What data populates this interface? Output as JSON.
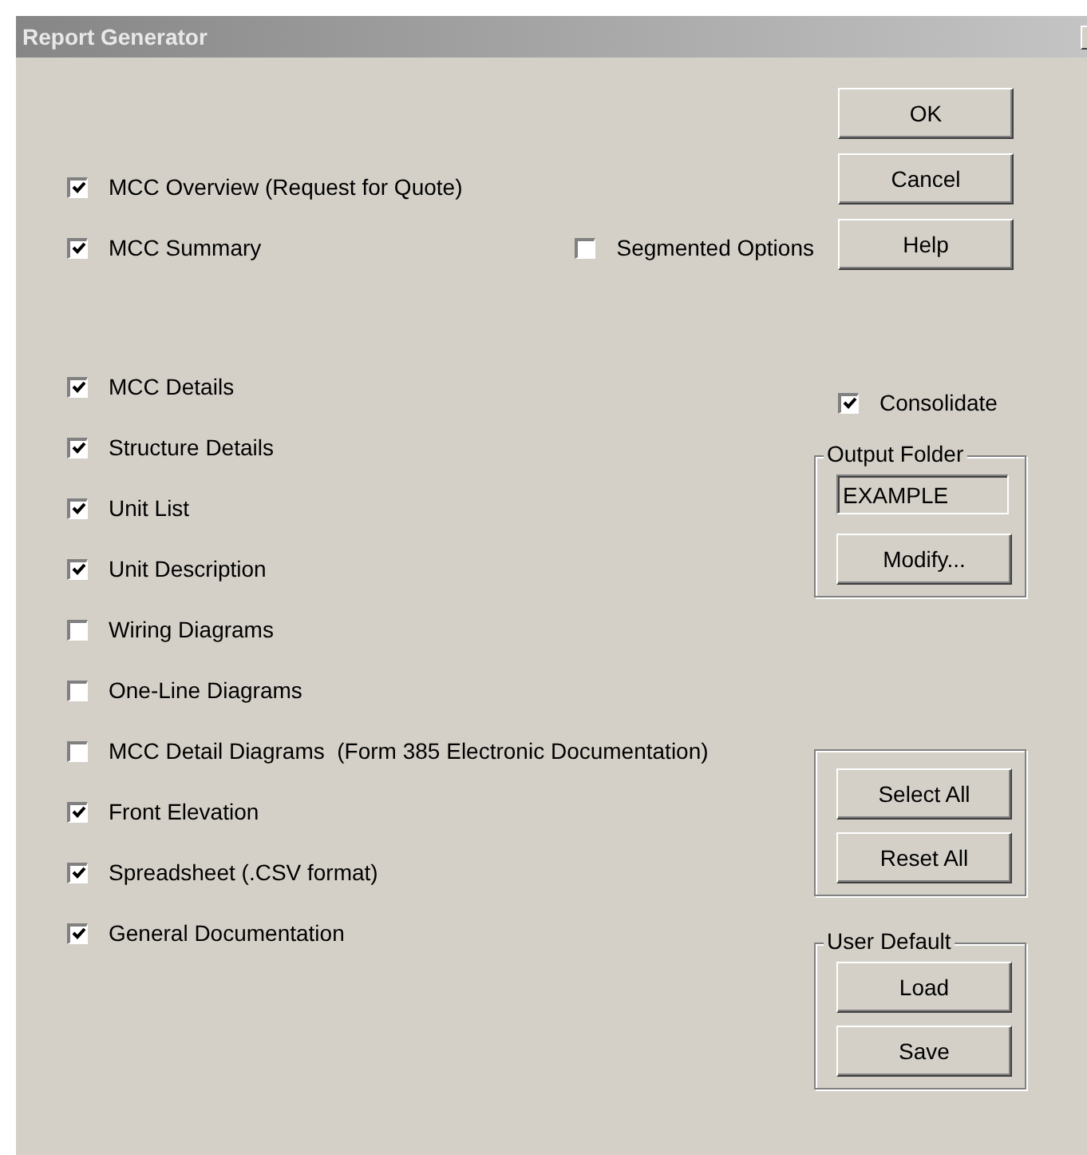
{
  "window": {
    "title": "Report Generator"
  },
  "summary_options": [
    {
      "label": "MCC Overview (Request for Quote)",
      "checked": true
    },
    {
      "label": "MCC Summary",
      "checked": true
    }
  ],
  "segmented_options": {
    "label": "Segmented Options",
    "checked": false
  },
  "detail_options": [
    {
      "label": "MCC Details",
      "checked": true
    },
    {
      "label": "Structure Details",
      "checked": true
    },
    {
      "label": "Unit List",
      "checked": true
    },
    {
      "label": "Unit Description",
      "checked": true
    },
    {
      "label": "Wiring Diagrams",
      "checked": false
    },
    {
      "label": "One-Line Diagrams",
      "checked": false
    },
    {
      "label": "MCC Detail Diagrams  (Form 385 Electronic Documentation)",
      "checked": false
    },
    {
      "label": "Front Elevation",
      "checked": true
    },
    {
      "label": "Spreadsheet (.CSV format)",
      "checked": true
    },
    {
      "label": "General Documentation",
      "checked": true
    }
  ],
  "dialog_buttons": [
    "OK",
    "Cancel",
    "Help"
  ],
  "consolidate": {
    "label": "Consolidate",
    "checked": true
  },
  "output_folder": {
    "label": "Output Folder",
    "value": "EXAMPLE",
    "button": "Modify..."
  },
  "selection_buttons": [
    "Select All",
    "Reset All"
  ],
  "user_default": {
    "label": "User Default",
    "buttons": [
      "Load",
      "Save"
    ]
  }
}
